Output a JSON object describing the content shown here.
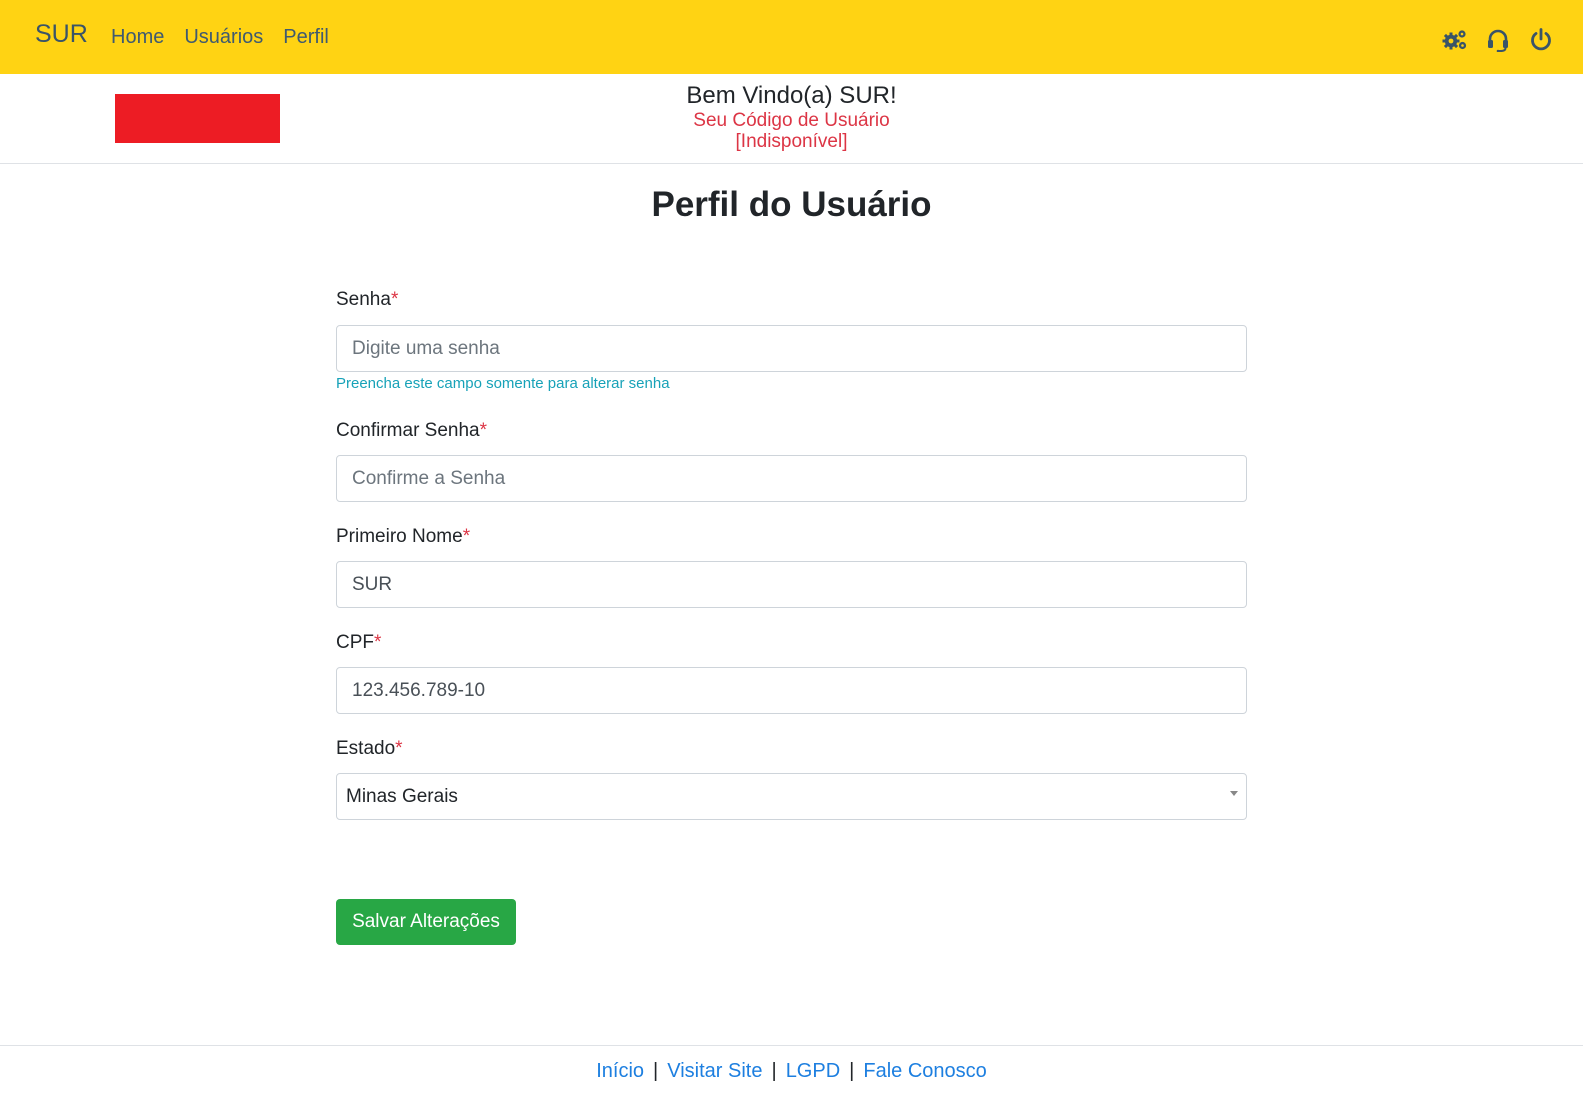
{
  "navbar": {
    "brand": "SUR",
    "links": [
      "Home",
      "Usuários",
      "Perfil"
    ],
    "icons": [
      "gears-icon",
      "headset-icon",
      "power-icon"
    ],
    "background_color": "#ffd313"
  },
  "welcome": {
    "title": "Bem Vindo(a) SUR!",
    "subtitle_line1": "Seu Código de Usuário",
    "subtitle_line2": "[Indisponível]",
    "logo_color": "#ed1c24"
  },
  "page": {
    "title": "Perfil do Usuário"
  },
  "form": {
    "required_marker": "*",
    "senha": {
      "label": "Senha",
      "placeholder": "Digite uma senha",
      "value": "",
      "help": "Preencha este campo somente para alterar senha"
    },
    "confirmar_senha": {
      "label": "Confirmar Senha",
      "placeholder": "Confirme a Senha",
      "value": ""
    },
    "primeiro_nome": {
      "label": "Primeiro Nome",
      "value": "SUR"
    },
    "cpf": {
      "label": "CPF",
      "value": "123.456.789-10"
    },
    "estado": {
      "label": "Estado",
      "selected": "Minas Gerais"
    },
    "save_button": "Salvar Alterações",
    "save_button_color": "#28a745"
  },
  "footer": {
    "links": [
      "Início",
      "Visitar Site",
      "LGPD",
      "Fale Conosco"
    ],
    "separator": "|"
  }
}
